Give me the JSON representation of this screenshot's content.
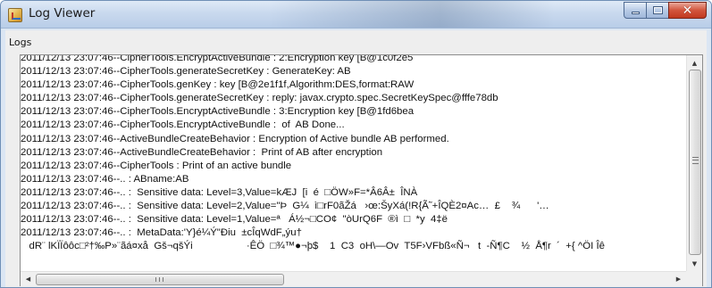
{
  "window": {
    "title": "Log Viewer",
    "icons": {
      "app": "java-cup-icon",
      "minimize": "minimize-icon",
      "maximize": "maximize-icon",
      "close": "close-icon"
    },
    "colors": {
      "close_button": "#c0391f",
      "titlebar": "#c9d9ee"
    }
  },
  "panel": {
    "label": "Logs"
  },
  "log": {
    "lines": [
      "2011/12/13 23:07:46--CipherTools.EncryptActiveBundle : 2:Encryption key [B@1c0f2e5",
      "2011/12/13 23:07:46--CipherTools.generateSecretKey : GenerateKey: AB",
      "2011/12/13 23:07:46--CipherTools.genKey : key [B@2e1f1f,Algorithm:DES,format:RAW",
      "2011/12/13 23:07:46--CipherTools.generateSecretKey : reply: javax.crypto.spec.SecretKeySpec@fffe78db",
      "2011/12/13 23:07:46--CipherTools.EncryptActiveBundle : 3:Encryption key [B@1fd6bea",
      "2011/12/13 23:07:46--CipherTools.EncryptActiveBundle :  of  AB Done...",
      "2011/12/13 23:07:46--ActiveBundleCreateBehavior : Encryption of Active bundle AB performed.",
      "2011/12/13 23:07:46--ActiveBundleCreateBehavior :  Print of AB after encryption",
      "2011/12/13 23:07:46--CipherTools : Print of an active bundle",
      "2011/12/13 23:07:46--.. : ABname:AB",
      "2011/12/13 23:07:46--.. :  Sensitive data: Level=3,Value=kÆJ  [i  é  □ÖW»F=*Â6Â±  ÎNÀ",
      "2011/12/13 23:07:46--.. :  Sensitive data: Level=2,Value=\"Þ  G¼  ì□rF0ãŽá   ›œ:ŠyXá(!R{Ã˜+ÎQÈ2¤Ac…  £    ¾      '…",
      "2011/12/13 23:07:46--.. :  Sensitive data: Level=1,Value=ª   Á½¬□CO¢  \"òUrQ6F  ®ì  □  *y  4‡ë",
      "2011/12/13 23:07:46--.. :  MetaData:'Y}é¼Ý\"Ðiu  ±cÎqWdF„ýu†",
      "   dR¨ lKÏÏôôc□²†‰P»¨ãá¤xå  Gš¬qšÝi                   ·ÊÖ  □¾™●¬þ$    1  C3  oH\\—Ov  T5F›VFbß«Ñ¬   t  -Ñ¶C    ½  Å¶r  ´  +{ ^ÖI Îê"
    ]
  },
  "scrollbars": {
    "vertical": {
      "position": 0.0,
      "visible_fraction": 0.9,
      "up_icon": "arrow-up-icon",
      "down_icon": "arrow-down-icon"
    },
    "horizontal": {
      "position": 0.0,
      "visible_fraction": 0.38,
      "left_icon": "arrow-left-icon",
      "right_icon": "arrow-right-icon"
    }
  }
}
